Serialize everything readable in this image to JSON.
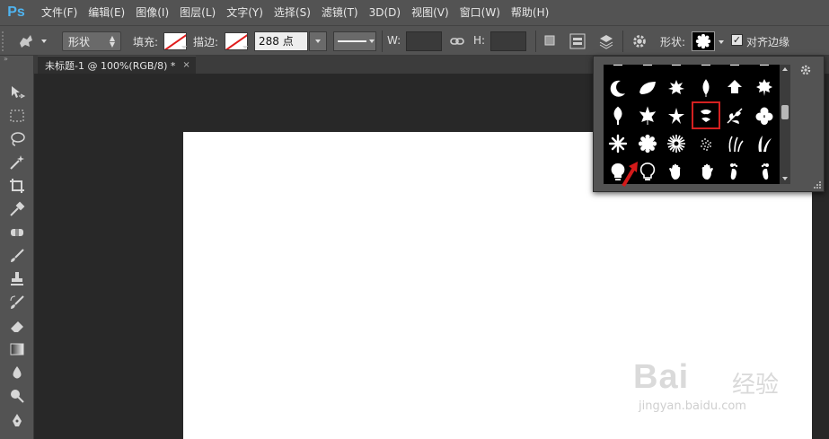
{
  "app": {
    "logo": "Ps"
  },
  "menu": [
    "文件(F)",
    "编辑(E)",
    "图像(I)",
    "图层(L)",
    "文字(Y)",
    "选择(S)",
    "滤镜(T)",
    "3D(D)",
    "视图(V)",
    "窗口(W)",
    "帮助(H)"
  ],
  "options": {
    "mode": "形状",
    "fill_label": "填充:",
    "stroke_label": "描边:",
    "stroke_size": "288 点",
    "width_label": "W:",
    "height_label": "H:",
    "shape_label": "形状:",
    "align_edges_label": "对齐边缘",
    "align_edges_checked": true,
    "no_color_line": "#e01c1c"
  },
  "document": {
    "tab_title": "未标题-1 @ 100%(RGB/8) *",
    "close_glyph": "×",
    "canvas_color": "#ffffff"
  },
  "toolbar_collapse_glyph": "»",
  "tools": [
    "move-tool-icon",
    "marquee-tool-icon",
    "lasso-tool-icon",
    "magic-wand-tool-icon",
    "crop-tool-icon",
    "eyedropper-tool-icon",
    "healing-brush-tool-icon",
    "brush-tool-icon",
    "clone-stamp-tool-icon",
    "history-brush-tool-icon",
    "eraser-tool-icon",
    "gradient-tool-icon",
    "blur-tool-icon",
    "dodge-tool-icon",
    "pen-tool-icon"
  ],
  "shape_picker": {
    "selected_index": 9,
    "shapes": [
      "crescent-moon-icon",
      "leaf-icon",
      "maple-leaf-icon",
      "ivy-leaf-icon",
      "birch-leaf-icon",
      "oak-leaf-icon",
      "leaf-small-icon",
      "maple-leaf-2-icon",
      "flower-5-petal-icon",
      "ornament-icon",
      "branch-icon",
      "clover-flower-icon",
      "star-flower-icon",
      "daisy-flower-icon",
      "spiky-flower-icon",
      "dots-cluster-icon",
      "grass-icon",
      "grass-tall-icon",
      "lightbulb-icon",
      "lightbulb-outline-icon",
      "hand-left-icon",
      "hand-right-icon",
      "foot-left-icon",
      "foot-right-icon"
    ]
  },
  "watermark": {
    "main": "Bai",
    "cn": "经验",
    "url": "jingyan.baidu.com"
  },
  "colors": {
    "chrome": "#535353",
    "workspace": "#282828",
    "selection_outline": "#d42020",
    "accent_blue": "#4fb4f0"
  }
}
